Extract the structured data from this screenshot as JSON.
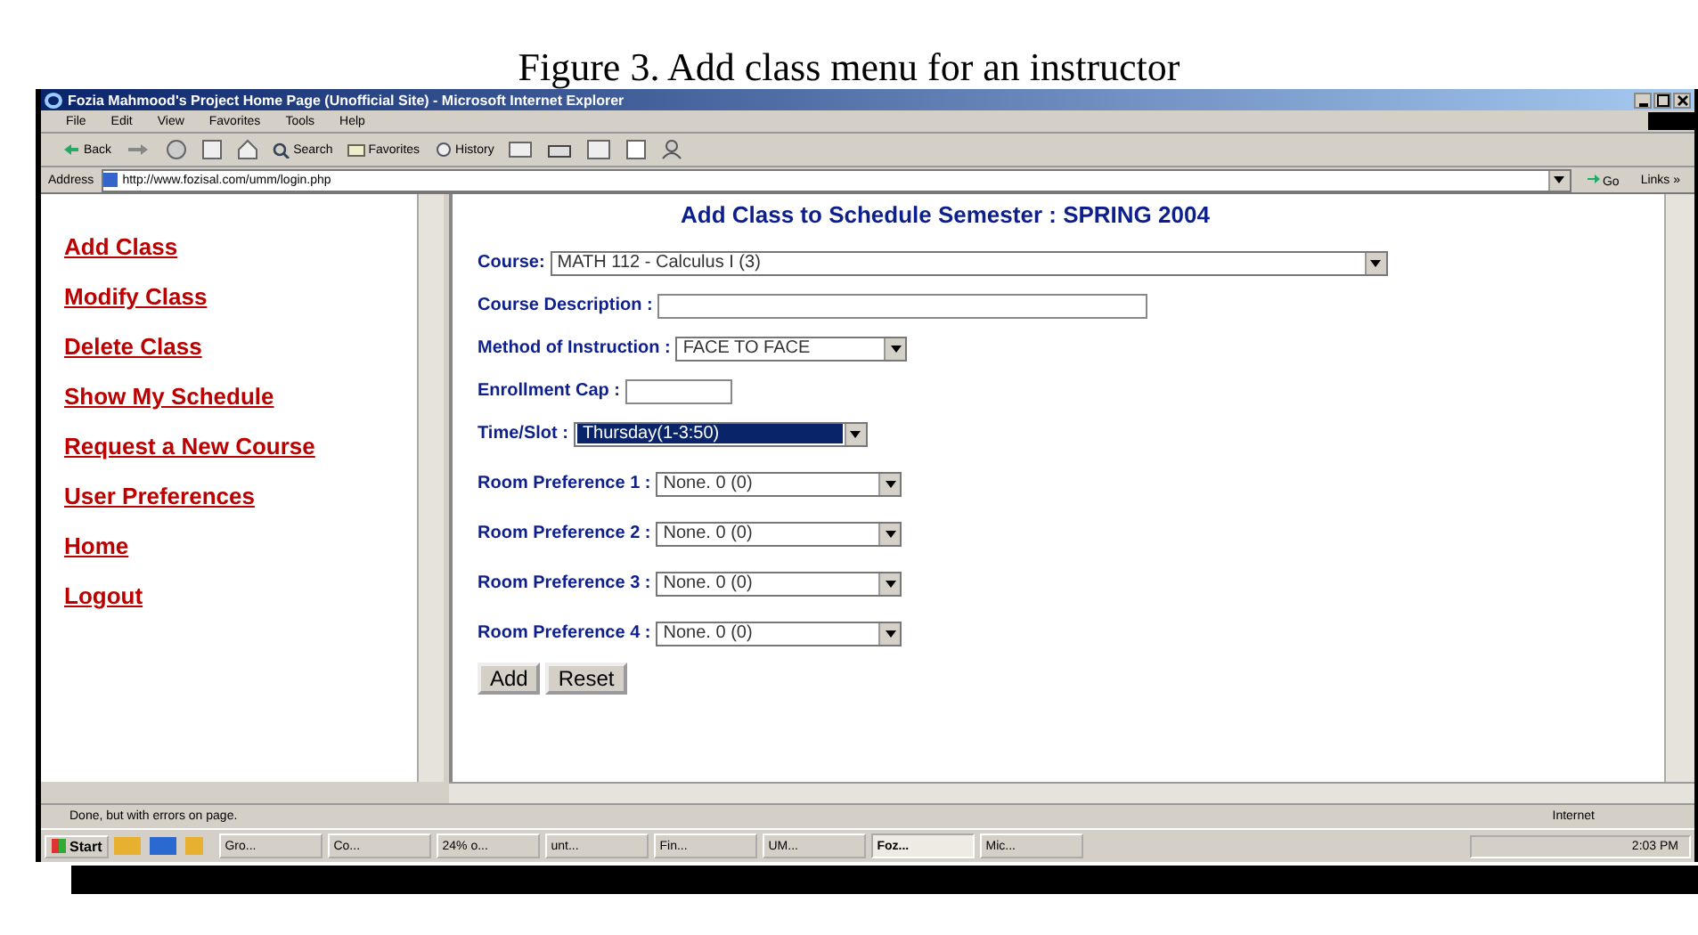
{
  "caption": "Figure 3.  Add class menu for an instructor",
  "window": {
    "title": "Fozia Mahmood's Project Home Page (Unofficial Site) - Microsoft Internet Explorer",
    "menu": [
      "File",
      "Edit",
      "View",
      "Favorites",
      "Tools",
      "Help"
    ],
    "toolbar": [
      {
        "label": "Back",
        "kind": "back"
      },
      {
        "label": "Search",
        "kind": "search"
      },
      {
        "label": "Favorites",
        "kind": "favorites"
      },
      {
        "label": "History",
        "kind": "history"
      }
    ],
    "address": {
      "label": "Address",
      "url": "http://www.fozisal.com/umm/login.php",
      "go": "Go",
      "links": "Links »"
    }
  },
  "sidebar": {
    "links": [
      "Add Class",
      "Modify Class",
      "Delete Class",
      "Show My Schedule",
      "Request a New Course",
      "User Preferences",
      "Home",
      "Logout"
    ]
  },
  "form": {
    "heading": "Add Class to Schedule Semester : SPRING 2004",
    "fields": [
      {
        "label": "Course:",
        "kind": "select",
        "value": "MATH 112 - Calculus I (3)",
        "highlighted": false
      },
      {
        "label": "Course Description :",
        "kind": "text",
        "highlighted": false
      },
      {
        "label": "Method of Instruction :",
        "kind": "select",
        "value": "FACE TO FACE",
        "highlighted": false
      },
      {
        "label": "Enrollment Cap :",
        "kind": "text",
        "highlighted": false
      },
      {
        "label": "Time/Slot :",
        "kind": "select",
        "value": "Thursday(1-3:50)",
        "highlighted": true
      },
      {
        "label": "Room Preference 1 :",
        "kind": "select",
        "value": "None. 0 (0)",
        "highlighted": false
      },
      {
        "label": "Room Preference 2 :",
        "kind": "select",
        "value": "None. 0 (0)",
        "highlighted": false
      },
      {
        "label": "Room Preference 3 :",
        "kind": "select",
        "value": "None. 0 (0)",
        "highlighted": false
      },
      {
        "label": "Room Preference 4 :",
        "kind": "select",
        "value": "None. 0 (0)",
        "highlighted": false
      }
    ],
    "buttons": [
      "Add",
      "Reset"
    ]
  },
  "status_bar": {
    "message": "Done, but with errors on page.",
    "zone": "Internet"
  },
  "taskbar": {
    "start": "Start",
    "items": [
      {
        "label": "Gro...",
        "selected": false
      },
      {
        "label": "Co...",
        "selected": false
      },
      {
        "label": "24% o...",
        "selected": false
      },
      {
        "label": "unt...",
        "selected": false
      },
      {
        "label": "Fin...",
        "selected": false
      },
      {
        "label": "UM...",
        "selected": false
      },
      {
        "label": "Foz...",
        "selected": true
      },
      {
        "label": "Mic...",
        "selected": false
      }
    ],
    "clock": "2:03 PM"
  }
}
